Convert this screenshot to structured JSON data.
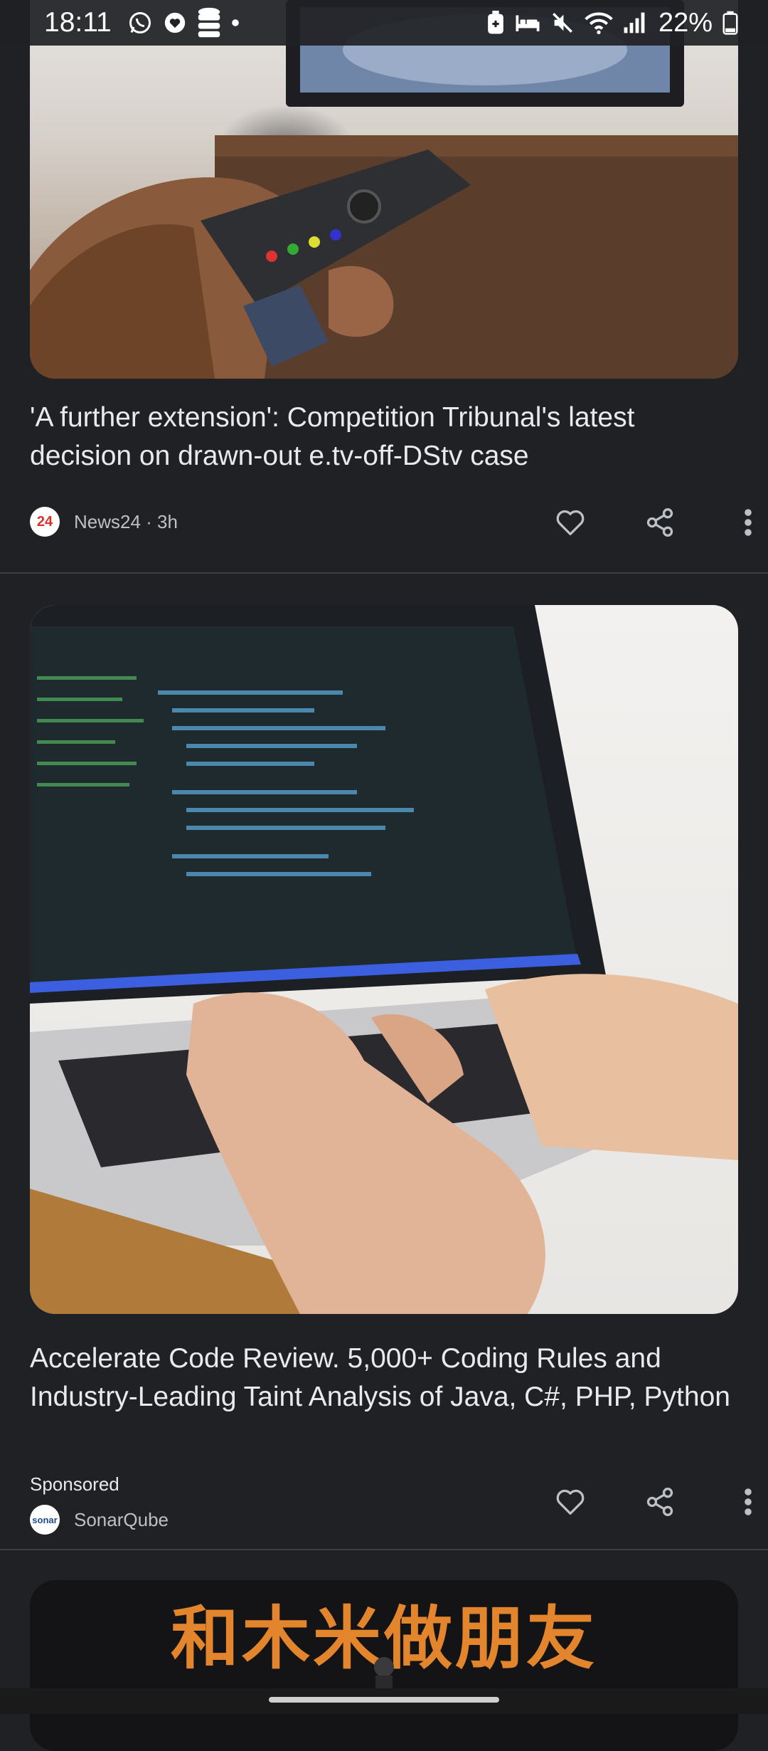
{
  "status_bar": {
    "time": "18:11",
    "battery": "22%",
    "icons": [
      "whatsapp-icon",
      "heart-face-icon",
      "database-icon",
      "dot-icon",
      "battery-saver-icon",
      "bed-icon",
      "mute-icon",
      "wifi-icon",
      "signal-icon",
      "battery-icon"
    ]
  },
  "articles": [
    {
      "image_desc_icon": "tv-remote-image",
      "headline": "'A further extension': Competition Tribunal's latest decision on drawn-out e.tv-off-DStv case",
      "source_logo_text": "24",
      "source": "News24 · 3h"
    },
    {
      "image_desc_icon": "laptop-code-image",
      "headline": "Accelerate Code Review. 5,000+ Coding Rules and Industry-Leading Taint Analysis of Java, C#, PHP, Python",
      "sponsored": "Sponsored",
      "source_logo_text": "sonar",
      "source": "SonarQube"
    },
    {
      "image_text": "和木米做朋友"
    }
  ],
  "colors": {
    "background": "#202124",
    "text": "#e8eaed",
    "secondary_text": "#bdc1c6",
    "divider": "#3c4043",
    "brand_news24": "#d9302b",
    "banner_text": "#e2852c"
  }
}
